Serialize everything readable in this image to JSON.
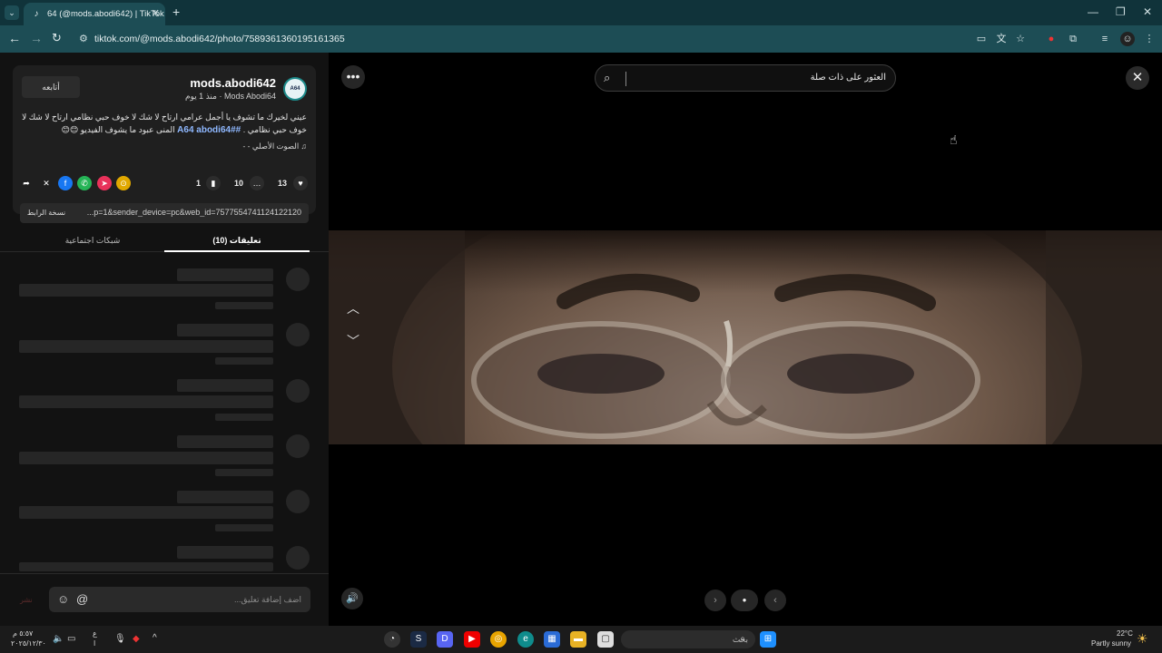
{
  "browser": {
    "tab_title": "64 (@mods.abodi642) | TikTok",
    "tab_icon": "tiktok-icon",
    "url": "tiktok.com/@mods.abodi642/photo/7589361360195161365"
  },
  "profile": {
    "follow_label": "أتابعه",
    "username": "mods.abodi642",
    "nickname": "Mods Abodi64 · منذ 1 يوم",
    "avatar_text": "A64",
    "description_part1": "عيني لخيرك ما تشوف يا أجمل عرامي ارتاح لا شك لا خوف حبي نظامي ارتاح لا شك لا خوف حبي نظامي .",
    "hashtags": "#A64 abodi64#",
    "description_part2": "المنى عبود ما يشوف الفيديو 😊😊",
    "music": "♫ الصوت الأصلي - -"
  },
  "actions": {
    "likes": "13",
    "comments": "10",
    "saves": "1"
  },
  "share": {
    "copy_label": "نسخة الرابط",
    "link": "...p=1&sender_device=pc&web_id=7577554741124122120"
  },
  "panel_tabs": {
    "comments": "(10) تعليقات",
    "social": "شبكات اجتماعية"
  },
  "comment_input": {
    "placeholder": "اضف إضافة تعليق...",
    "send_label": "نشر"
  },
  "viewer": {
    "search_text": "العثور على ذات صلة"
  },
  "taskbar": {
    "search_label": "بحث",
    "time": "٥:٥٧ م",
    "date": "٢٠٢٥/١٢/٣٠",
    "lang": "ع",
    "lang2": "ا",
    "weather_temp": "22°C",
    "weather_desc": "Partly sunny"
  }
}
